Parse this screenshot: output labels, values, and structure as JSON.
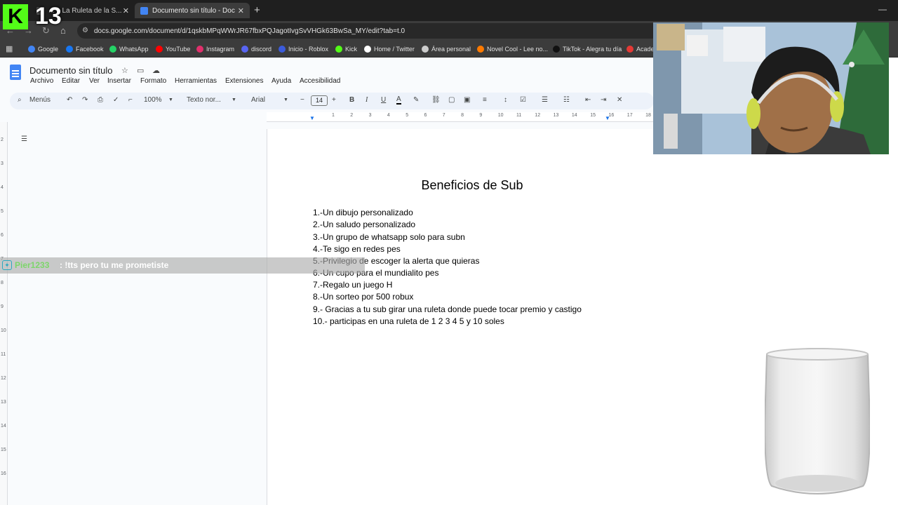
{
  "overlay": {
    "count": "13"
  },
  "browser": {
    "tabs": [
      {
        "title": "... – La Ruleta de la S...",
        "active": false
      },
      {
        "title": "Documento sin título - Docum...",
        "active": true
      }
    ],
    "url": "docs.google.com/document/d/1qskbMPqWWrJR67fbxPQJagotIvgSvVHGk63BwSa_MY/edit?tab=t.0",
    "bookmarks": [
      {
        "label": "Google",
        "color": "#4285f4"
      },
      {
        "label": "Facebook",
        "color": "#1877f2"
      },
      {
        "label": "WhatsApp",
        "color": "#25d366"
      },
      {
        "label": "YouTube",
        "color": "#ff0000"
      },
      {
        "label": "Instagram",
        "color": "#e1306c"
      },
      {
        "label": "discord",
        "color": "#5865f2"
      },
      {
        "label": "Inicio - Roblox",
        "color": "#3b5bdb"
      },
      {
        "label": "Kick",
        "color": "#53fc18"
      },
      {
        "label": "Home / Twitter",
        "color": "#ffffff"
      },
      {
        "label": "Área personal",
        "color": "#cccccc"
      },
      {
        "label": "Novel Cool - Lee no...",
        "color": "#ff7a00"
      },
      {
        "label": "TikTok - Alegra tu día",
        "color": "#111111"
      },
      {
        "label": "Acade",
        "color": "#e53935"
      }
    ]
  },
  "docs": {
    "title": "Documento sin título",
    "menu": [
      "Archivo",
      "Editar",
      "Ver",
      "Insertar",
      "Formato",
      "Herramientas",
      "Extensiones",
      "Ayuda",
      "Accesibilidad"
    ],
    "toolbar": {
      "search": "Menús",
      "zoom": "100%",
      "style": "Texto nor...",
      "font": "Arial",
      "font_size": "14"
    },
    "heading": "Beneficios de Sub",
    "items": [
      "1.-Un dibujo personalizado",
      "2.-Un saludo personalizado",
      "3.-Un grupo de whatsapp solo para subn",
      "4.-Te sigo en redes pes",
      "5.-Privilegio de escoger la alerta que quieras",
      "6.-Un cupo para el mundialito pes",
      "7.-Regalo un juego H",
      "8.-Un sorteo por 500 robux",
      "9.- Gracias a tu sub girar una ruleta donde puede tocar premio y castigo",
      "10.- participas en una ruleta de 1 2 3 4 5 y 10 soles"
    ],
    "ruler_numbers": [
      "1",
      "2",
      "3",
      "4",
      "5",
      "6",
      "7",
      "8",
      "9",
      "10",
      "11",
      "12",
      "13",
      "14",
      "15",
      "16",
      "17",
      "18"
    ],
    "vruler_numbers": [
      "2",
      "3",
      "4",
      "5",
      "6",
      "7",
      "8",
      "9",
      "10",
      "11",
      "12",
      "13",
      "14",
      "15",
      "16"
    ]
  },
  "chat": {
    "user": "Pier1233",
    "message": ": !tts pero tu me prometiste",
    "user_color": "#7cd66a"
  }
}
